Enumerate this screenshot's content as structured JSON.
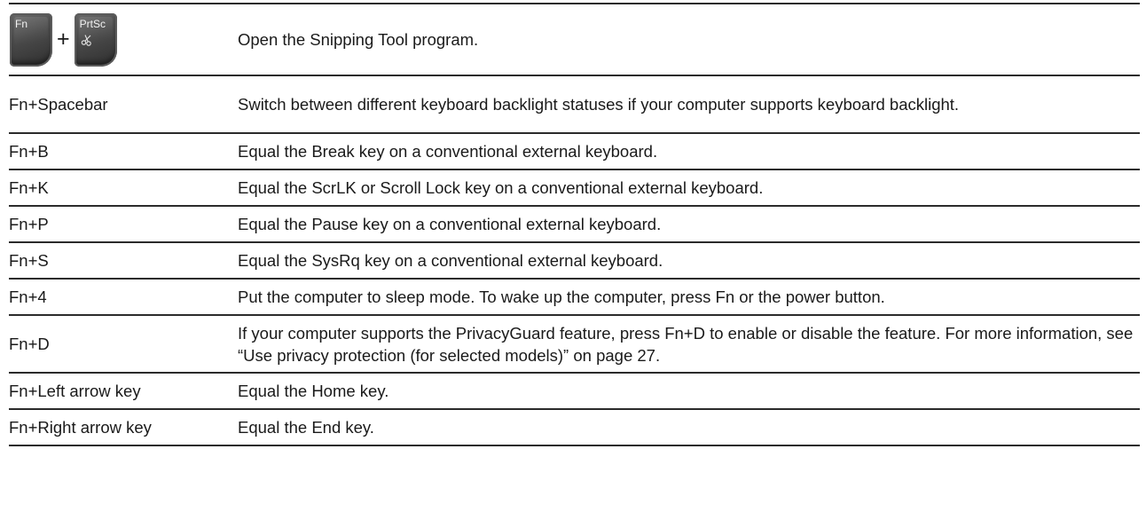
{
  "rows": [
    {
      "keys": {
        "first_key": "Fn",
        "plus": "+",
        "second_key": "PrtSc"
      },
      "description": "Open the Snipping Tool program."
    },
    {
      "key": "Fn+Spacebar",
      "description": "Switch between different keyboard backlight statuses if your computer supports keyboard backlight."
    },
    {
      "key": "Fn+B",
      "description": "Equal the Break key on a conventional external keyboard."
    },
    {
      "key": "Fn+K",
      "description": "Equal the ScrLK or Scroll Lock key on a conventional external keyboard."
    },
    {
      "key": "Fn+P",
      "description": "Equal the Pause key on a conventional external keyboard."
    },
    {
      "key": "Fn+S",
      "description": "Equal the SysRq key on a conventional external keyboard."
    },
    {
      "key": "Fn+4",
      "description": "Put the computer to sleep mode. To wake up the computer, press Fn or the power button."
    },
    {
      "key": "Fn+D",
      "description": "If your computer supports the PrivacyGuard feature, press Fn+D to enable or disable the feature. For more information, see “Use privacy protection (for selected models)” on page 27."
    },
    {
      "key": "Fn+Left arrow key",
      "description": "Equal the Home key."
    },
    {
      "key": "Fn+Right arrow key",
      "description": "Equal the End key."
    }
  ],
  "icons": {
    "fn_key": "fn-key-icon",
    "prtsc_key": "prtsc-key-icon",
    "snipping_glyph": "scissors-icon"
  },
  "colors": {
    "keycap": "#4a4a4a",
    "rule": "#2b2b2b",
    "text": "#1a1a1a"
  }
}
